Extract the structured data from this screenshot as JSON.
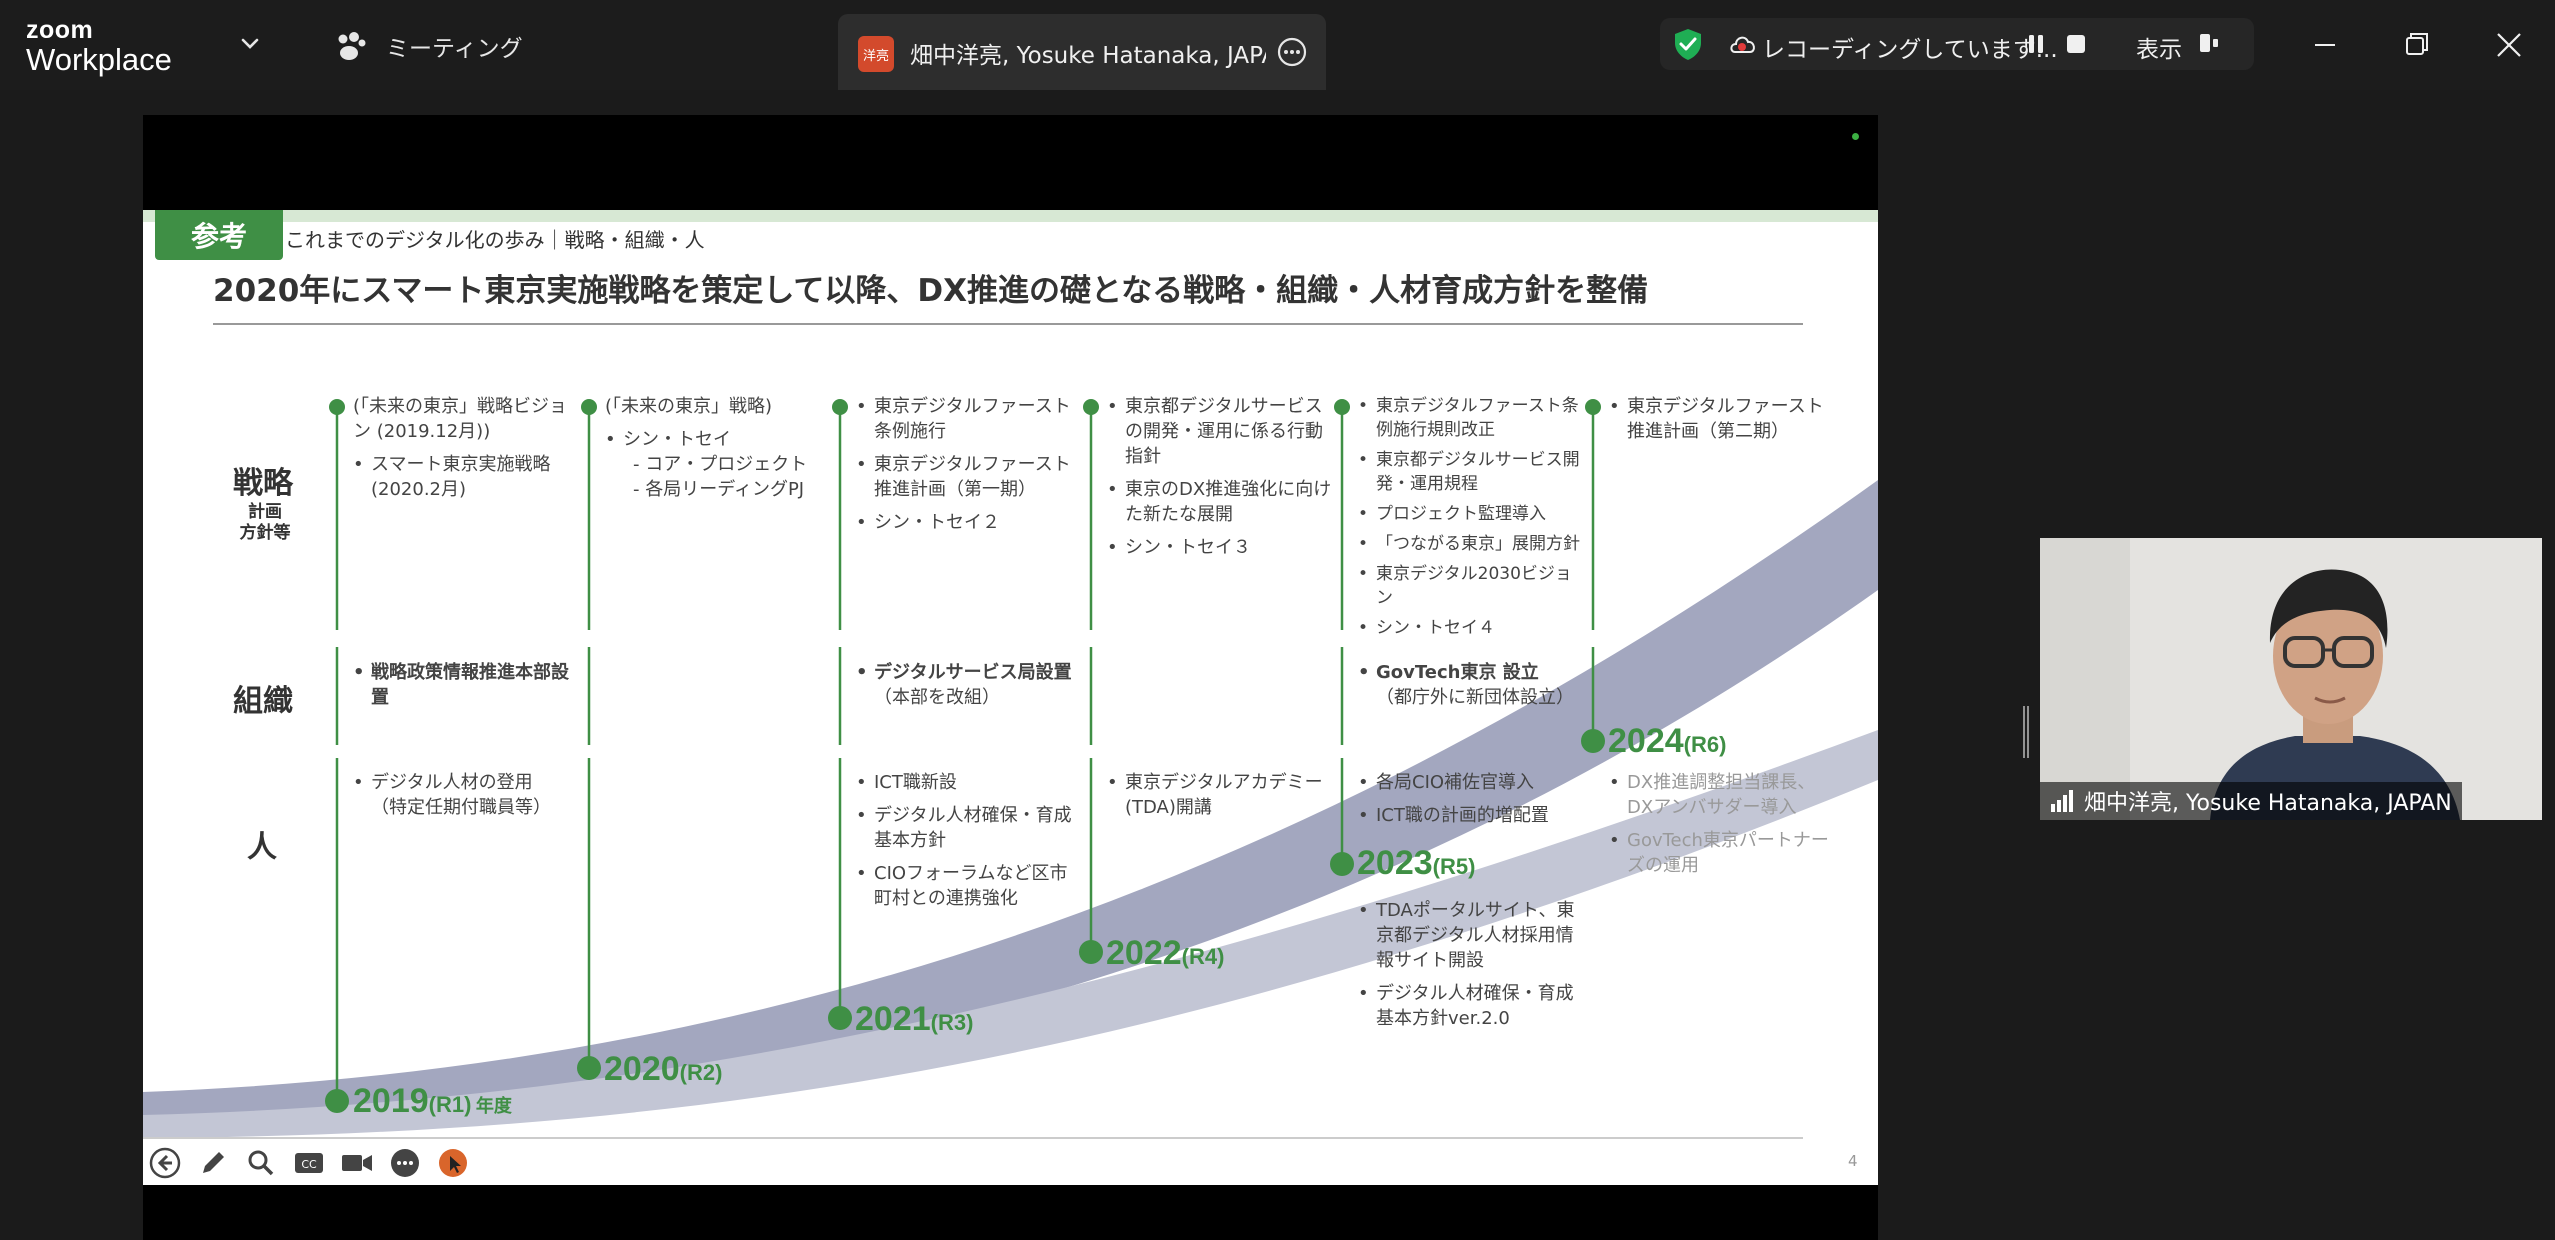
{
  "app": {
    "logo_top": "zoom",
    "logo_bottom": "Workplace",
    "meeting_label": "ミーティング",
    "tab_avatar": "洋亮",
    "tab_title": "畑中洋亮, Yosuke Hatanaka, JAPA",
    "recording_text": "レコーディングしています...",
    "view_label": "表示"
  },
  "slide": {
    "badge": "参考",
    "breadcrumb": "これまでのデジタル化の歩み｜戦略・組織・人",
    "headline": "2020年にスマート東京実施戦略を策定して以降、DX推進の礎となる戦略・組織・人材育成方針を整備",
    "row_labels": {
      "strategy": "戦略",
      "strategy_sub": "計画\n方針等",
      "org": "組織",
      "people": "人"
    },
    "page_number": "4",
    "years": [
      {
        "year": "2019",
        "era": "(R1)",
        "suffix": "年度"
      },
      {
        "year": "2020",
        "era": "(R2)",
        "suffix": ""
      },
      {
        "year": "2021",
        "era": "(R3)",
        "suffix": ""
      },
      {
        "year": "2022",
        "era": "(R4)",
        "suffix": ""
      },
      {
        "year": "2023",
        "era": "(R5)",
        "suffix": ""
      },
      {
        "year": "2024",
        "era": "(R6)",
        "suffix": ""
      }
    ],
    "strategy": {
      "y2019": [
        "(「未来の東京」戦略ビジョン (2019.12月))",
        "スマート東京実施戦略 (2020.2月)"
      ],
      "y2020": [
        "(「未来の東京」戦略)",
        "シン・トセイ",
        "- コア・プロジェクト",
        "- 各局リーディングPJ"
      ],
      "y2021": [
        "東京デジタルファースト条例施行",
        "東京デジタルファースト推進計画（第一期）",
        "シン・トセイ２"
      ],
      "y2022": [
        "東京都デジタルサービスの開発・運用に係る行動指針",
        "東京のDX推進強化に向けた新たな展開",
        "シン・トセイ３"
      ],
      "y2023": [
        "東京デジタルファースト条例施行規則改正",
        "東京都デジタルサービス開発・運用規程",
        "プロジェクト監理導入",
        "「つながる東京」展開方針",
        "東京デジタル2030ビジョン",
        "シン・トセイ４"
      ],
      "y2024": [
        "東京デジタルファースト推進計画（第二期）"
      ]
    },
    "org": {
      "y2019": [
        "戦略政策情報推進本部設置"
      ],
      "y2021": [
        "デジタルサービス局設置",
        "（本部を改組）"
      ],
      "y2023": [
        "GovTech東京 設立",
        "（都庁外に新団体設立）"
      ]
    },
    "people": {
      "y2019": [
        "デジタル人材の登用",
        "（特定任期付職員等）"
      ],
      "y2021": [
        "ICT職新設",
        "デジタル人材確保・育成基本方針",
        "CIOフォーラムなど区市町村との連携強化"
      ],
      "y2022": [
        "東京デジタルアカデミー(TDA)開講"
      ],
      "y2023": [
        "各局CIO補佐官導入",
        "ICT職の計画的増配置",
        "TDAポータルサイト、東京都デジタル人材採用情報サイト開設",
        "デジタル人材確保・育成基本方針ver.2.0"
      ],
      "y2024": [
        "DX推進調整担当課長、DXアンバサダー導入",
        "GovTech東京パートナーズの運用"
      ]
    }
  },
  "video": {
    "participant_name": "畑中洋亮, Yosuke Hatanaka, JAPAN"
  },
  "colors": {
    "accent_green": "#3f8f45",
    "shield_green": "#1fae54",
    "swoosh": "#9da1b8",
    "record_red": "#e23b3b"
  },
  "icons": [
    "chevron-down-icon",
    "paw-icon",
    "more-icon",
    "shield-check-icon",
    "cloud-record-icon",
    "pause-icon",
    "stop-icon",
    "view-icon",
    "minimize-icon",
    "restore-icon",
    "close-icon",
    "back-arrow-icon",
    "pen-icon",
    "search-icon",
    "cc-icon",
    "camera-icon",
    "ellipsis-icon",
    "pointer-icon",
    "signal-icon"
  ]
}
